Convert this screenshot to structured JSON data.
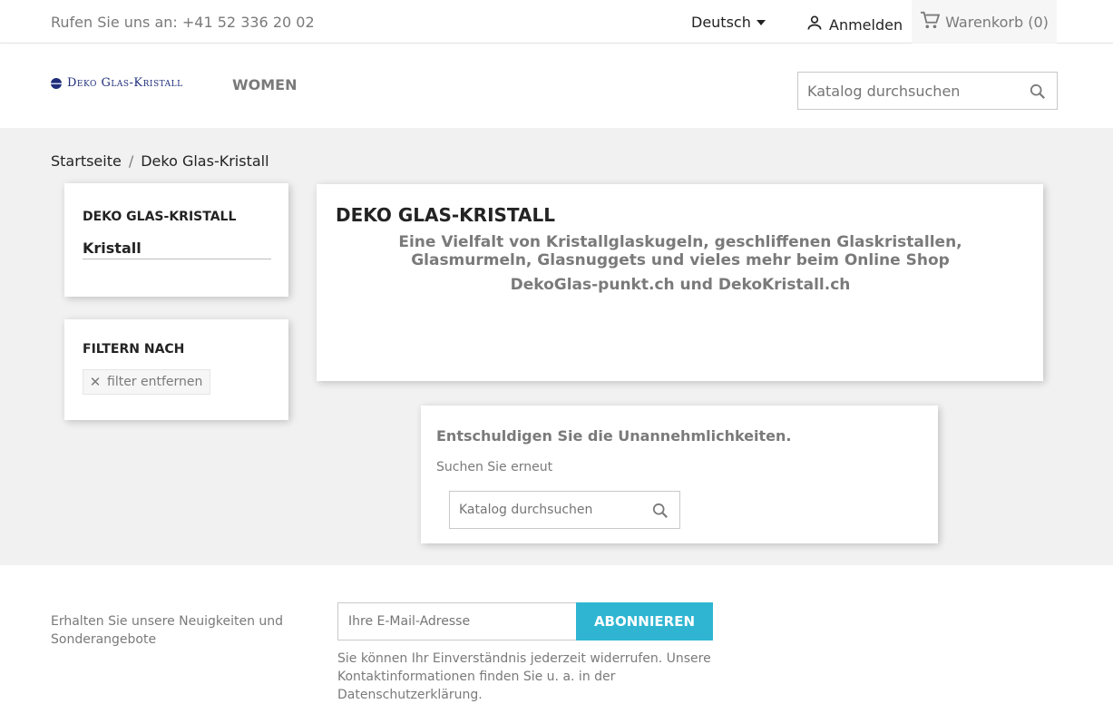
{
  "topbar": {
    "contact": "Rufen Sie uns an: +41 52 336 20 02",
    "language": "Deutsch",
    "signin": "Anmelden",
    "cart": "Warenkorb (0)"
  },
  "header": {
    "logo_text": "Deko Glas-Kristall",
    "nav_women": "WOMEN",
    "search_placeholder": "Katalog durchsuchen"
  },
  "breadcrumb": {
    "items": [
      "Startseite",
      "Deko Glas-Kristall"
    ],
    "separator": "/"
  },
  "sidebar": {
    "category_heading": "DEKO GLAS-KRISTALL",
    "category_item": "Kristall",
    "filter_heading": "FILTERN NACH",
    "filter_remove": "filter entfernen"
  },
  "category": {
    "title": "DEKO GLAS-KRISTALL",
    "description": "Eine Vielfalt von Kristallglaskugeln, geschliffenen Glaskristallen, Glasmurmeln, Glasnuggets und vieles mehr beim Online Shop",
    "description2": "DekoGlas-punkt.ch und DekoKristall.ch"
  },
  "not_found": {
    "heading": "Entschuldigen Sie die Unannehmlichkeiten.",
    "text": "Suchen Sie erneut",
    "search_placeholder": "Katalog durchsuchen"
  },
  "newsletter": {
    "label": "Erhalten Sie unsere Neuigkeiten und Sonderangebote",
    "email_placeholder": "Ihre E-Mail-Adresse",
    "button": "ABONNIEREN",
    "note": "Sie können Ihr Einverständnis jederzeit widerrufen. Unsere Kontaktinformationen finden Sie u. a. in der Datenschutzerklärung."
  },
  "colors": {
    "accent": "#2fb5d2",
    "background": "#f1f1f1",
    "muted_text": "#7a7a7a"
  },
  "icons": {
    "language_caret": "caret-down-icon",
    "user": "user-icon",
    "cart": "cart-icon",
    "search": "search-icon",
    "close": "close-icon"
  }
}
